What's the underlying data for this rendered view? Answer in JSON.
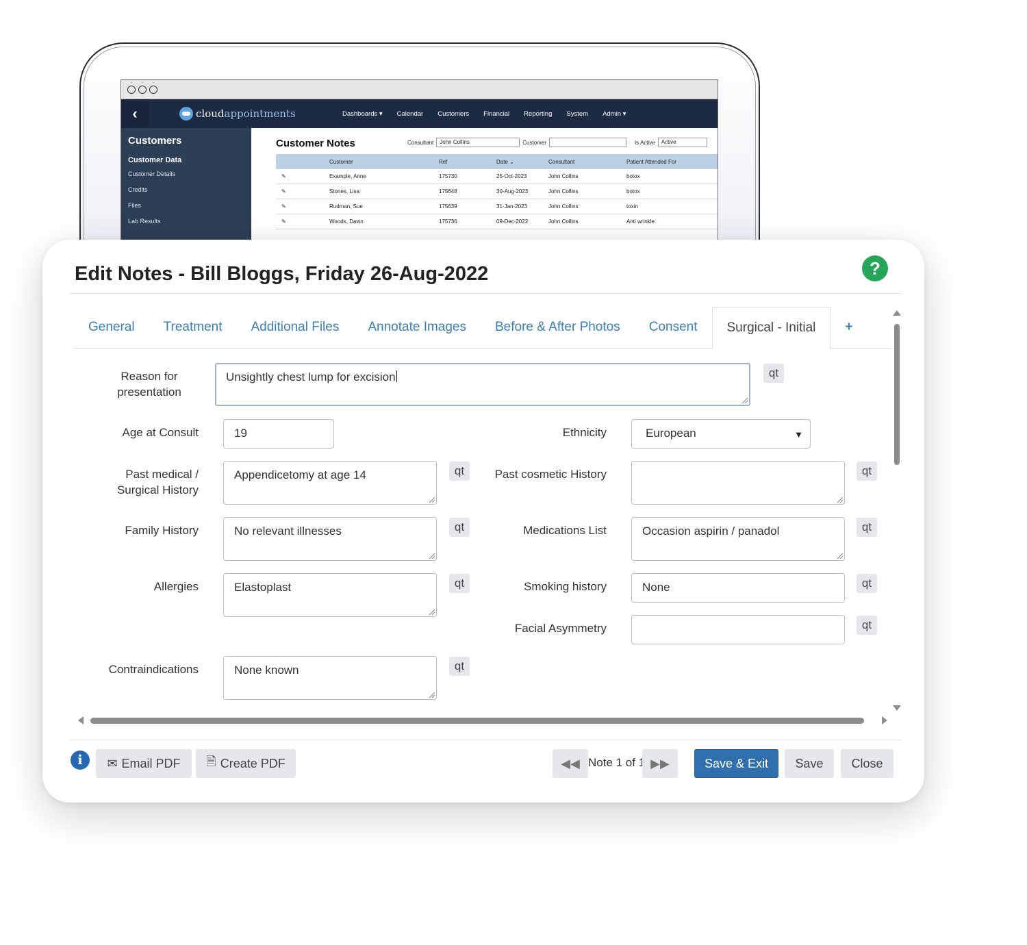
{
  "background_app": {
    "logo": {
      "brand_a": "cloud",
      "brand_b": "appointments"
    },
    "menu": [
      "Dashboards ▾",
      "Calendar",
      "Customers",
      "Financial",
      "Reporting",
      "System",
      "Admin ▾"
    ],
    "sidebar": {
      "title": "Customers",
      "section": "Customer Data",
      "items": [
        "Customer Details",
        "Credits",
        "Files",
        "Lab Results"
      ]
    },
    "page_title": "Customer Notes",
    "filters": {
      "consultant_label": "Consultant",
      "consultant_value": "John Collins",
      "customer_label": "Customer",
      "customer_value": "",
      "active_label": "Is Active",
      "active_value": "Active"
    },
    "table": {
      "headers": [
        "Customer",
        "Ref",
        "Date ⌄",
        "Consultant",
        "Patient Attended For"
      ],
      "rows": [
        [
          "Example, Anne",
          "175730",
          "25-Oct-2023",
          "John Collins",
          "botox"
        ],
        [
          "Stones, Lisa",
          "175648",
          "30-Aug-2023",
          "John Collins",
          "botox"
        ],
        [
          "Rudman, Sue",
          "175639",
          "31-Jan-2023",
          "John Collins",
          "toxin"
        ],
        [
          "Woods, Dawn",
          "175736",
          "09-Dec-2022",
          "John Collins",
          "Anti wrinkle"
        ]
      ]
    }
  },
  "modal": {
    "title": "Edit Notes - Bill Bloggs, Friday 26-Aug-2022",
    "tabs": [
      "General",
      "Treatment",
      "Additional Files",
      "Annotate Images",
      "Before & After Photos",
      "Consent",
      "Surgical - Initial",
      "+"
    ],
    "active_tab": "Surgical - Initial",
    "qt_label": "qt",
    "fields": {
      "reason_label": "Reason for presentation",
      "reason_value": "Unsightly chest lump for excision",
      "age_label": "Age at Consult",
      "age_value": "19",
      "ethnicity_label": "Ethnicity",
      "ethnicity_value": "European",
      "past_medical_label": "Past medical / Surgical History",
      "past_medical_value": "Appendicetomy at age 14",
      "past_cosmetic_label": "Past cosmetic History",
      "past_cosmetic_value": "",
      "family_label": "Family History",
      "family_value": "No relevant illnesses",
      "medications_label": "Medications List",
      "medications_value": "Occasion aspirin / panadol",
      "allergies_label": "Allergies",
      "allergies_value": "Elastoplast",
      "smoking_label": "Smoking history",
      "smoking_value": "None",
      "facial_label": "Facial Asymmetry",
      "facial_value": "",
      "contra_label": "Contraindications",
      "contra_value": "None known"
    },
    "footer": {
      "email_pdf": "Email PDF",
      "create_pdf": "Create PDF",
      "pager": "Note 1 of 1",
      "save_exit": "Save & Exit",
      "save": "Save",
      "close": "Close"
    }
  },
  "colors": {
    "nav_bg": "#1c2a44",
    "sidebar_bg": "#2d3e57",
    "tab_link": "#3a7fb8",
    "primary_button": "#2f6fad",
    "help_icon": "#27a65a",
    "info_icon": "#2868b3"
  }
}
